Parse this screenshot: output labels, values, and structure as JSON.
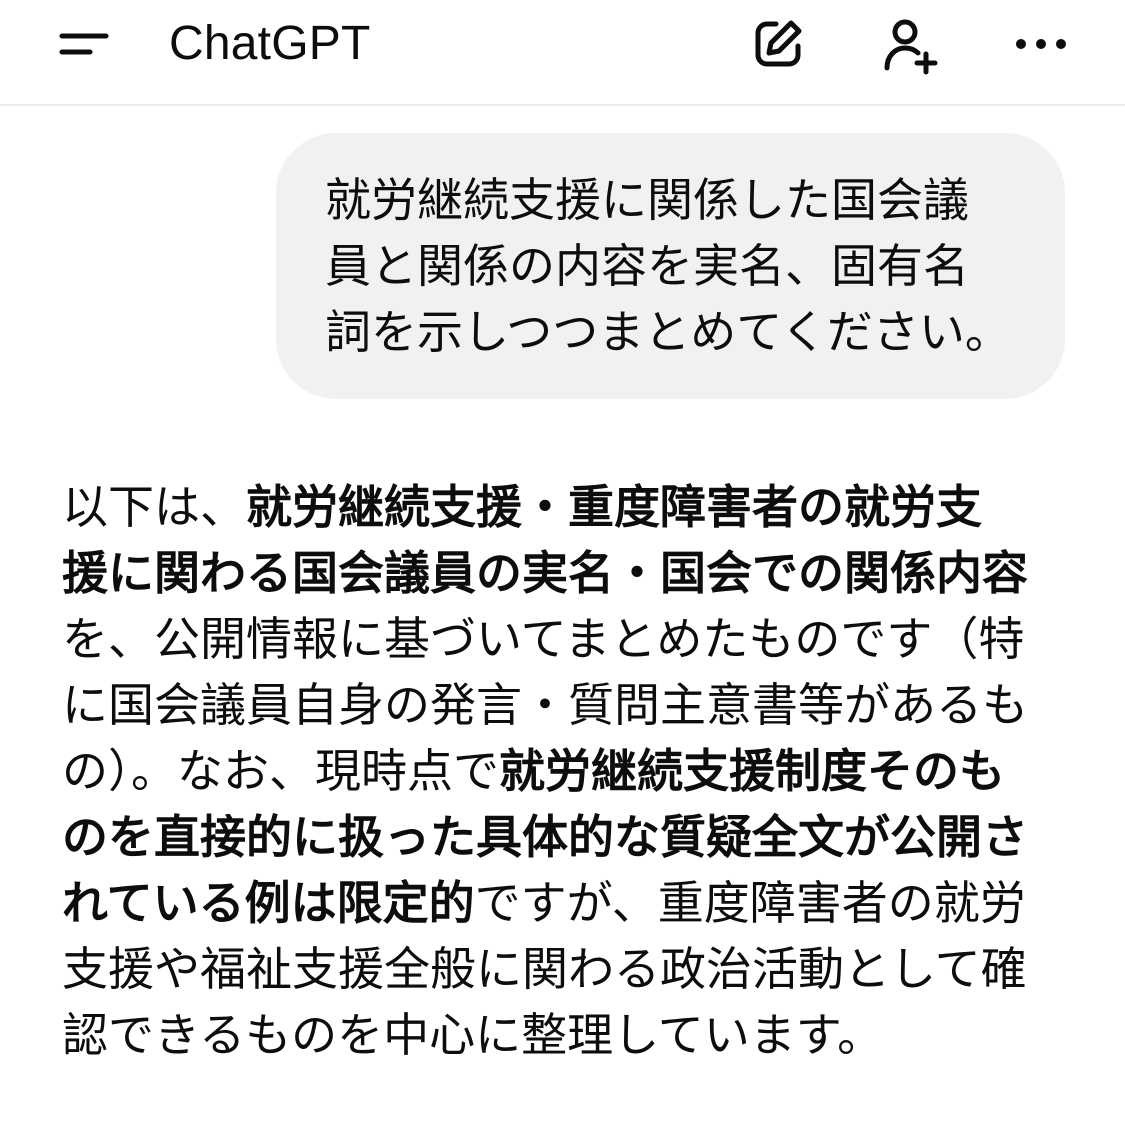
{
  "header": {
    "title": "ChatGPT",
    "icons": {
      "menu": "menu-icon",
      "new_chat": "edit-icon",
      "add_user": "add-user-icon",
      "more": "more-horizontal-icon"
    }
  },
  "user_message": {
    "lines": [
      "就労継続支援に関係した国会議",
      "員と関係の内容を実名、固有名",
      "詞を示しつつまとめてください。"
    ]
  },
  "assistant_message": {
    "lines": [
      [
        {
          "t": "以下は、",
          "b": false
        },
        {
          "t": "就労継続支援・重度障害者の就労支",
          "b": true
        }
      ],
      [
        {
          "t": "援に関わる国会議員の実名・国会での関係内容",
          "b": true
        }
      ],
      [
        {
          "t": "を、公開情報に基づいてまとめたものです（特",
          "b": false
        }
      ],
      [
        {
          "t": "に国会議員自身の発言・質問主意書等があるも",
          "b": false
        }
      ],
      [
        {
          "t": "の）。なお、現時点で",
          "b": false
        },
        {
          "t": "就労継続支援制度そのも",
          "b": true
        }
      ],
      [
        {
          "t": "のを直接的に扱った具体的な質疑全文が公開さ",
          "b": true
        }
      ],
      [
        {
          "t": "れている例は限定的",
          "b": true
        },
        {
          "t": "ですが、重度障害者の就労",
          "b": false
        }
      ],
      [
        {
          "t": "支援や福祉支援全般に関わる政治活動として確",
          "b": false
        }
      ],
      [
        {
          "t": "認できるものを中心に整理しています。",
          "b": false
        }
      ]
    ]
  },
  "colors": {
    "text": "#0d0d0d",
    "bubble": "#f1f1f1",
    "divider": "#ececec",
    "background": "#ffffff"
  }
}
